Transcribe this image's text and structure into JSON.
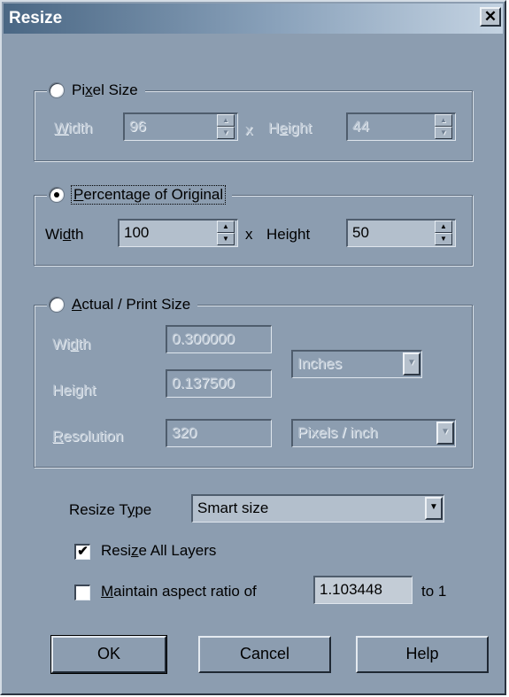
{
  "window": {
    "title": "Resize",
    "close_glyph": "✕"
  },
  "pixel_size": {
    "label_pre": "Pi",
    "label_u": "x",
    "label_post": "el Size",
    "width_pre": "",
    "width_u": "W",
    "width_post": "idth",
    "width_value": "96",
    "x_sep": "x",
    "height_pre": "H",
    "height_u": "e",
    "height_post": "ight",
    "height_value": "44"
  },
  "percentage": {
    "label_u": "P",
    "label_post": "ercentage of Original",
    "width_pre": "Wi",
    "width_u": "d",
    "width_post": "th",
    "width_value": "100",
    "x_sep": "x",
    "height_pre": "Hei",
    "height_u": "g",
    "height_post": "ht",
    "height_value": "50"
  },
  "actual": {
    "label_u": "A",
    "label_post": "ctual / Print Size",
    "width_pre": "Wi",
    "width_u": "d",
    "width_post": "th",
    "width_value": "0.300000",
    "height_pre": "Hei",
    "height_u": "g",
    "height_post": "ht",
    "height_value": "0.137500",
    "res_u": "R",
    "res_post": "esolution",
    "res_value": "320",
    "units": "Inches",
    "res_units": "Pixels / inch"
  },
  "resize_type": {
    "pre": "Resize T",
    "u": "y",
    "post": "pe",
    "value": "Smart size"
  },
  "resize_all": {
    "pre": "Resi",
    "u": "z",
    "post": "e All Layers",
    "checked": true,
    "mark": "✔"
  },
  "maintain": {
    "u": "M",
    "post": "aintain aspect ratio of",
    "value": "1.103448",
    "suffix": "to 1",
    "checked": false
  },
  "buttons": {
    "ok": "OK",
    "cancel": "Cancel",
    "help": "Help"
  },
  "icons": {
    "spin_up": "▲",
    "spin_down": "▼",
    "dropdown": "▼"
  }
}
